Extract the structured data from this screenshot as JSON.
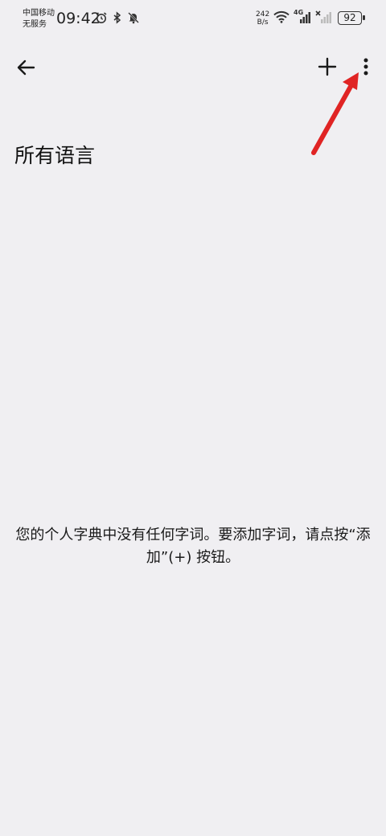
{
  "status_bar": {
    "carrier_line1": "中国移动",
    "carrier_line2": "无服务",
    "time": "09:42",
    "net_speed_value": "242",
    "net_speed_unit": "B/s",
    "network_type": "4G",
    "battery": "92"
  },
  "toolbar": {
    "back_icon": "arrow-left",
    "add_icon": "plus",
    "more_icon": "more-vertical"
  },
  "page": {
    "title": "所有语言",
    "empty_message": "您的个人字典中没有任何字词。要添加字词，请点按“添加”(+) 按钮。"
  },
  "annotation": {
    "arrow_color": "#e02424"
  }
}
